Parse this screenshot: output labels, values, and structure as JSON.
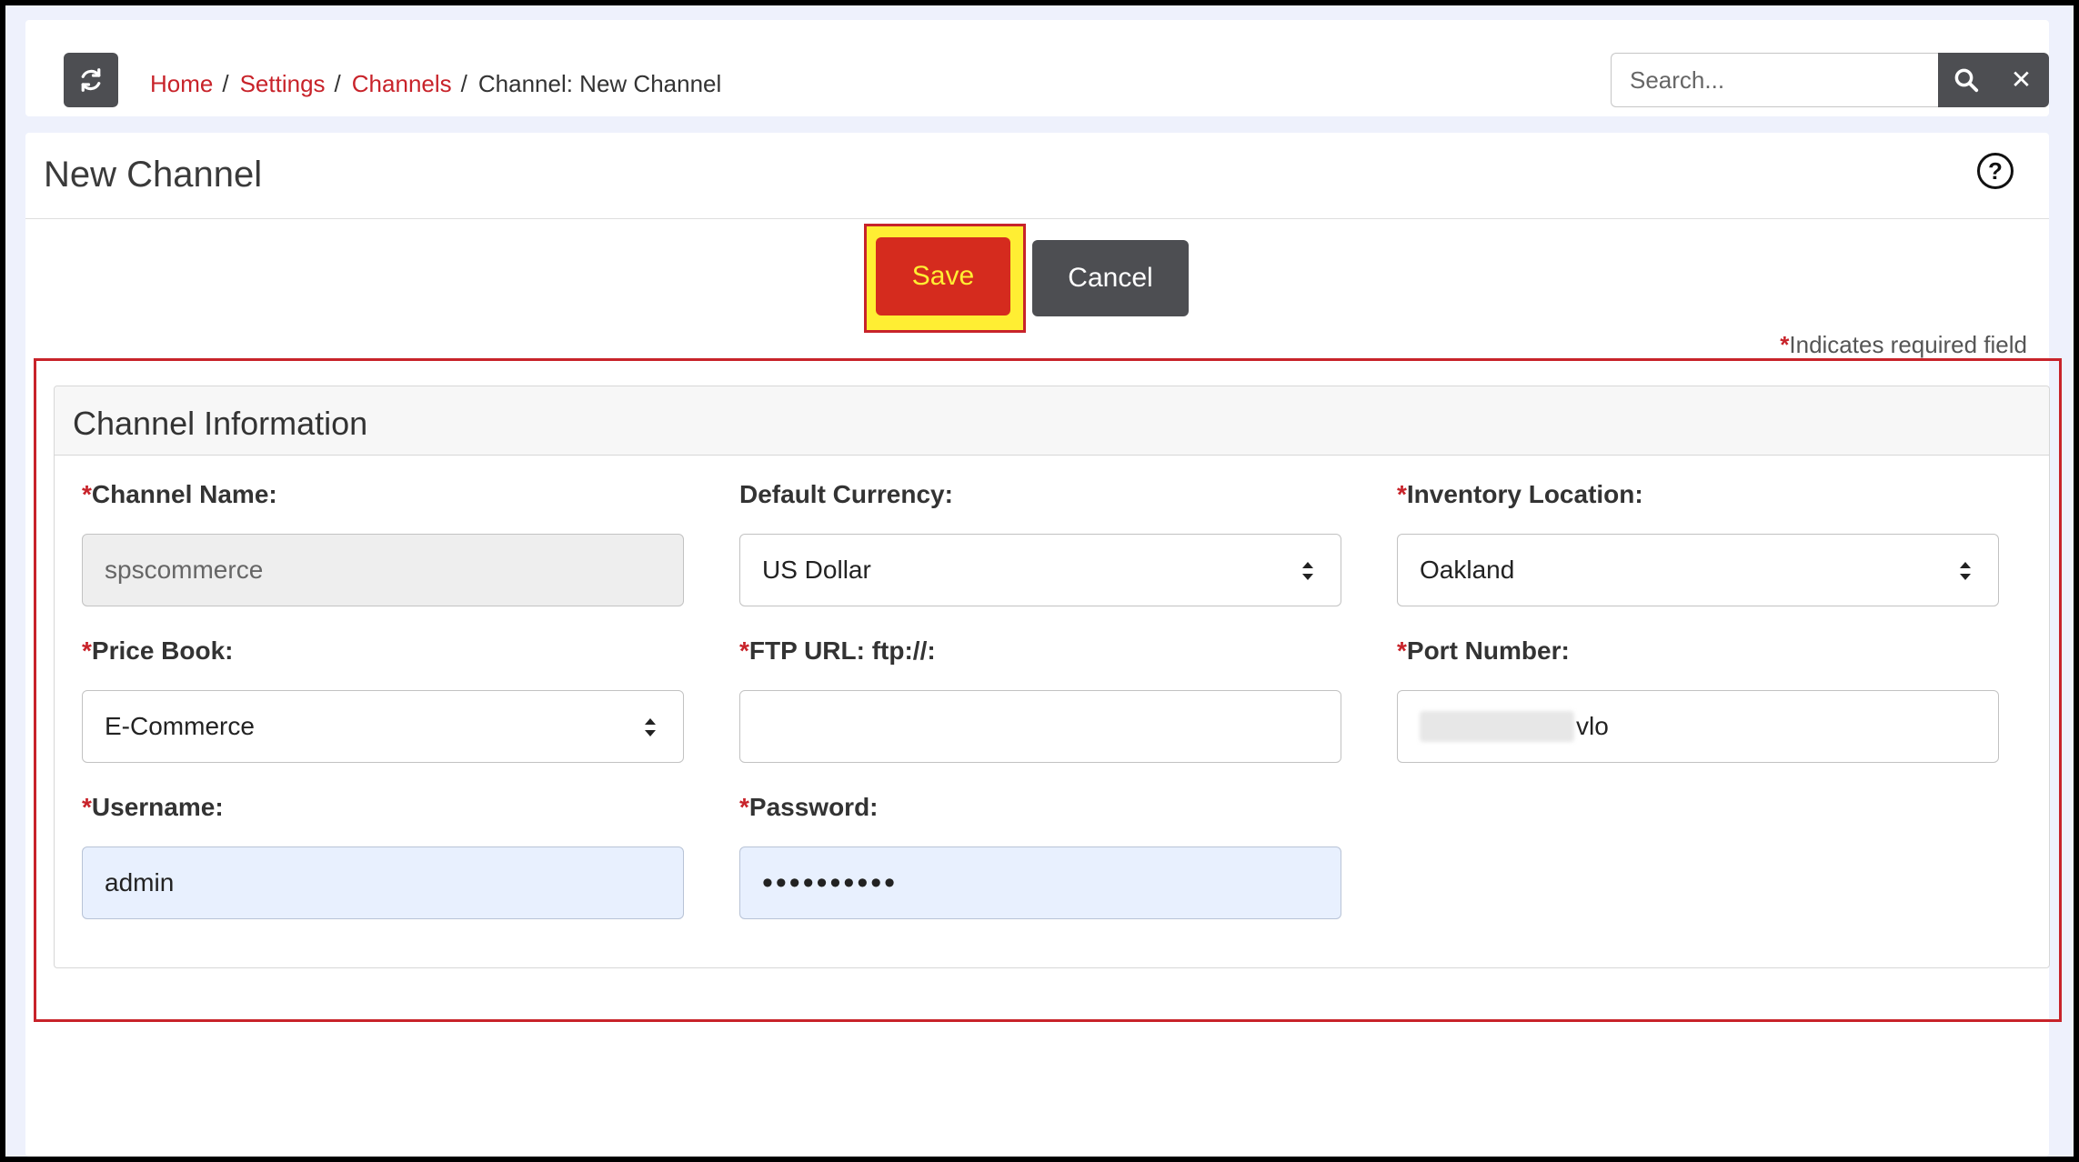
{
  "breadcrumb": {
    "home": "Home",
    "settings": "Settings",
    "channels": "Channels",
    "current": "Channel: New Channel",
    "separator": "/"
  },
  "search": {
    "placeholder": "Search..."
  },
  "page": {
    "title": "New Channel",
    "save_label": "Save",
    "cancel_label": "Cancel",
    "required_star": "*",
    "required_note": "Indicates required field"
  },
  "section": {
    "title": "Channel Information"
  },
  "fields": {
    "channel_name": {
      "label": "Channel Name:",
      "value": "spscommerce"
    },
    "default_currency": {
      "label": "Default Currency:",
      "value": "US Dollar"
    },
    "inventory_location": {
      "label": "Inventory Location:",
      "value": "Oakland"
    },
    "price_book": {
      "label": "Price Book:",
      "value": "E-Commerce"
    },
    "ftp_url": {
      "label": "FTP URL: ftp://:",
      "value": ""
    },
    "port_number": {
      "label": "Port Number:",
      "value": "vlo"
    },
    "username": {
      "label": "Username:",
      "value": "admin"
    },
    "password": {
      "label": "Password:",
      "value": "••••••••••"
    }
  },
  "icons": {
    "refresh": "refresh-icon",
    "search": "search-icon",
    "close": "close-icon",
    "help": "help-icon",
    "select": "select-arrows-icon"
  },
  "colors": {
    "accent_red": "#c8232a",
    "save_button": "#d52b1e",
    "save_text": "#ffee33",
    "dark_button": "#4d4e52",
    "background": "#eef1fc",
    "autofill": "#e8f0fe"
  }
}
